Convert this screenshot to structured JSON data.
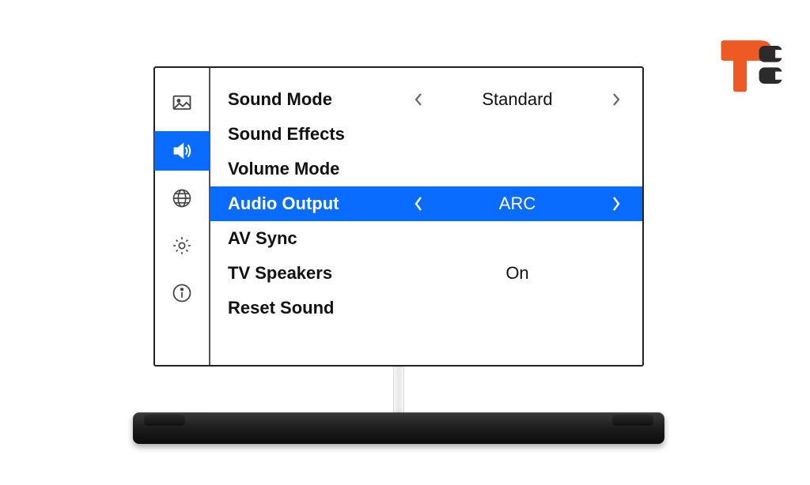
{
  "colors": {
    "accent": "#0a6bff",
    "logo_orange": "#ee5a24",
    "logo_dark": "#2b2b2b"
  },
  "sidebar": {
    "selected_index": 1,
    "items": [
      {
        "name": "picture-icon"
      },
      {
        "name": "sound-icon"
      },
      {
        "name": "network-icon"
      },
      {
        "name": "settings-icon"
      },
      {
        "name": "info-icon"
      }
    ]
  },
  "menu": {
    "items": [
      {
        "label": "Sound Mode",
        "value": "Standard",
        "has_chevrons": true,
        "selected": false
      },
      {
        "label": "Sound Effects",
        "value": "",
        "has_chevrons": false,
        "selected": false
      },
      {
        "label": "Volume Mode",
        "value": "",
        "has_chevrons": false,
        "selected": false
      },
      {
        "label": "Audio Output",
        "value": "ARC",
        "has_chevrons": true,
        "selected": true
      },
      {
        "label": "AV Sync",
        "value": "",
        "has_chevrons": false,
        "selected": false
      },
      {
        "label": "TV Speakers",
        "value": "On",
        "has_chevrons": false,
        "selected": false
      },
      {
        "label": "Reset Sound",
        "value": "",
        "has_chevrons": false,
        "selected": false
      }
    ]
  },
  "device": {
    "type": "soundbar"
  },
  "logo": {
    "name": "tc-logo"
  }
}
